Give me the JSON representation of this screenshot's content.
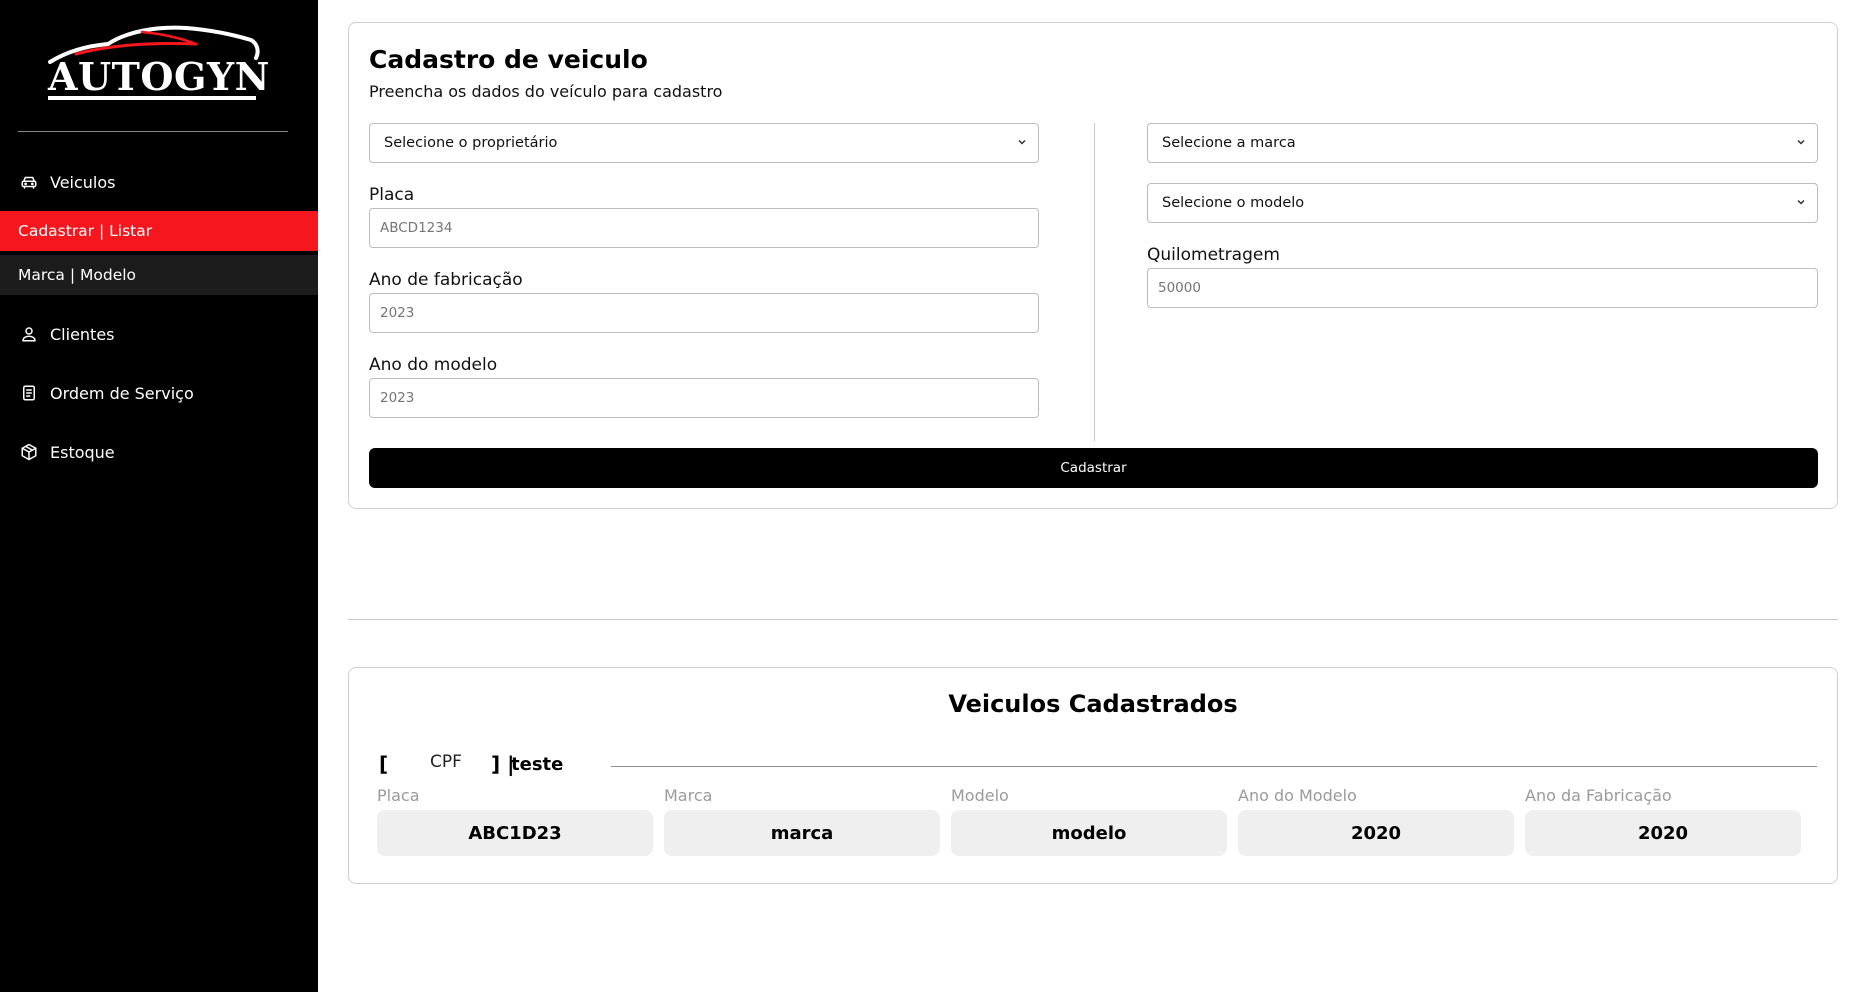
{
  "brand": {
    "name": "AUTOGYN",
    "accent_color": "#f5161e"
  },
  "sidebar": {
    "items": [
      {
        "label": "Veiculos",
        "icon": "car-icon"
      },
      {
        "label": "Clientes",
        "icon": "user-icon"
      },
      {
        "label": "Ordem de Serviço",
        "icon": "document-icon"
      },
      {
        "label": "Estoque",
        "icon": "box-icon"
      }
    ],
    "veiculos_subitems": [
      {
        "label": "Cadastrar | Listar",
        "active": true
      },
      {
        "label": "Marca | Modelo",
        "active": false
      }
    ]
  },
  "form": {
    "title": "Cadastro de veiculo",
    "subtitle": "Preencha os dados do veículo para cadastro",
    "owner_select": "Selecione o proprietário",
    "brand_select": "Selecione a marca",
    "model_select": "Selecione o modelo",
    "placa": {
      "label": "Placa",
      "placeholder": "ABCD1234"
    },
    "ano_fabricacao": {
      "label": "Ano de fabricação",
      "placeholder": "2023"
    },
    "ano_modelo": {
      "label": "Ano do modelo",
      "placeholder": "2023"
    },
    "quilometragem": {
      "label": "Quilometragem",
      "placeholder": "50000"
    },
    "submit_label": "Cadastrar"
  },
  "list": {
    "title": "Veiculos Cadastrados",
    "owner": {
      "open_bracket": "[",
      "cpf": "CPF",
      "close_bracket": "] |",
      "name": "teste"
    },
    "columns": [
      "Placa",
      "Marca",
      "Modelo",
      "Ano do Modelo",
      "Ano da Fabricação"
    ],
    "vehicle": {
      "placa": "ABC1D23",
      "marca": "marca",
      "modelo": "modelo",
      "ano_modelo": "2020",
      "ano_fabricacao": "2020"
    }
  }
}
